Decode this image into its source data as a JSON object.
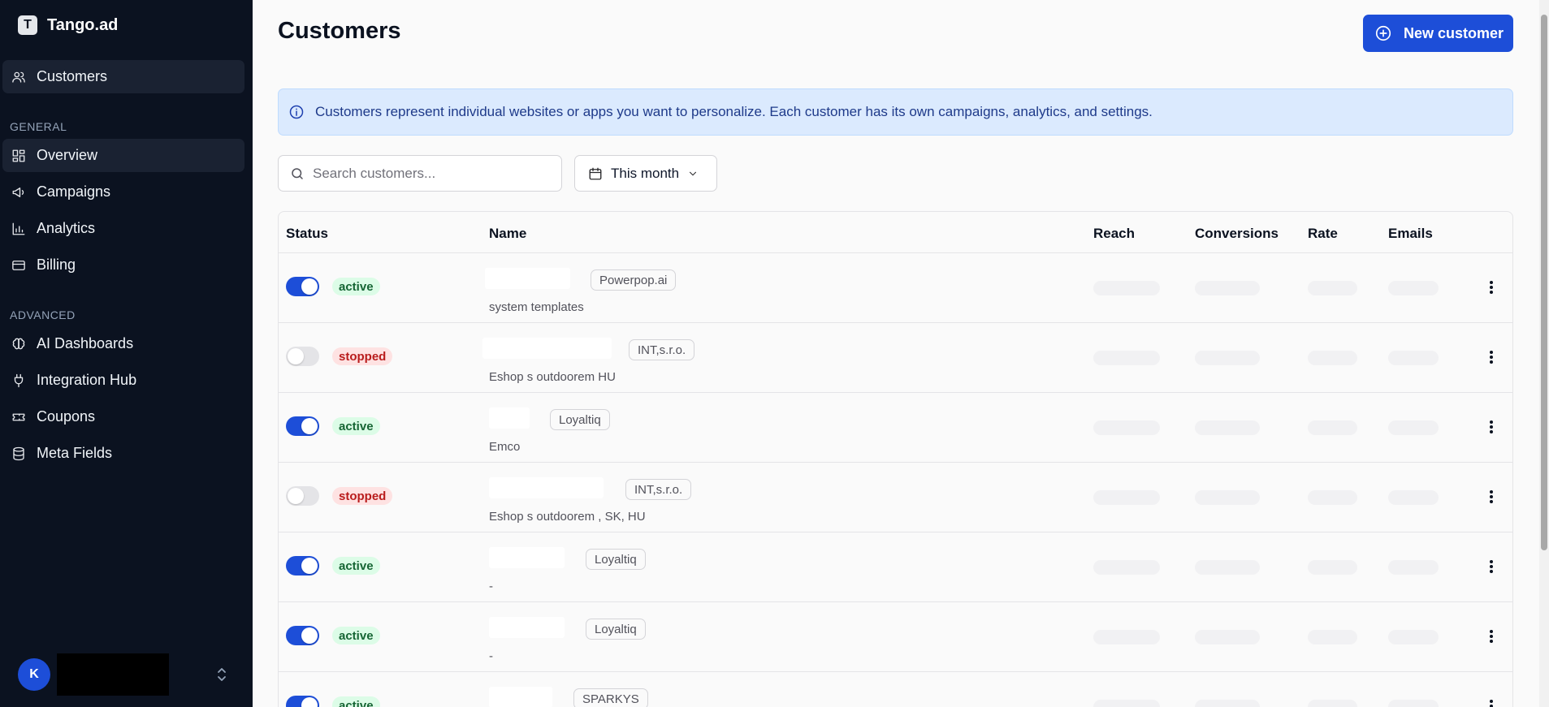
{
  "sidebar": {
    "brand": {
      "logo_letter": "T",
      "name": "Tango.ad"
    },
    "top_item": {
      "label": "Customers",
      "icon": "users-icon"
    },
    "sections": [
      {
        "label": "GENERAL",
        "items": [
          {
            "label": "Overview",
            "icon": "grid-icon",
            "active": true
          },
          {
            "label": "Campaigns",
            "icon": "megaphone-icon"
          },
          {
            "label": "Analytics",
            "icon": "bar-chart-icon"
          },
          {
            "label": "Billing",
            "icon": "credit-card-icon"
          }
        ]
      },
      {
        "label": "ADVANCED",
        "items": [
          {
            "label": "AI Dashboards",
            "icon": "brain-icon"
          },
          {
            "label": "Integration Hub",
            "icon": "plug-icon"
          },
          {
            "label": "Coupons",
            "icon": "ticket-icon"
          },
          {
            "label": "Meta Fields",
            "icon": "database-icon"
          }
        ]
      }
    ],
    "user": {
      "initial": "K"
    }
  },
  "main": {
    "title": "Customers",
    "new_button": "New customer",
    "info": "Customers represent individual websites or apps you want to personalize. Each customer has its own campaigns, analytics, and settings.",
    "search": {
      "placeholder": "Search customers...",
      "value": ""
    },
    "date_filter": "This month",
    "table": {
      "columns": {
        "status": "Status",
        "name": "Name",
        "reach": "Reach",
        "conversions": "Conversions",
        "rate": "Rate",
        "emails": "Emails"
      },
      "rows": [
        {
          "enabled": true,
          "status": "active",
          "org": "Powerpop.ai",
          "sub": "system templates"
        },
        {
          "enabled": false,
          "status": "stopped",
          "org": "INT,s.r.o.",
          "sub": "Eshop s outdoorem HU"
        },
        {
          "enabled": true,
          "status": "active",
          "org": "Loyaltiq",
          "sub": "Emco"
        },
        {
          "enabled": false,
          "status": "stopped",
          "org": "INT,s.r.o.",
          "sub": "Eshop s outdoorem , SK, HU"
        },
        {
          "enabled": true,
          "status": "active",
          "org": "Loyaltiq",
          "sub": "-"
        },
        {
          "enabled": true,
          "status": "active",
          "org": "Loyaltiq",
          "sub": "-"
        },
        {
          "enabled": true,
          "status": "active",
          "org": "SPARKYS",
          "sub": ""
        }
      ]
    }
  },
  "colors": {
    "sidebar_bg": "#0b1220",
    "accent": "#1d4ed8",
    "active_badge": "#dcfce7",
    "stopped_badge": "#fee2e2"
  }
}
